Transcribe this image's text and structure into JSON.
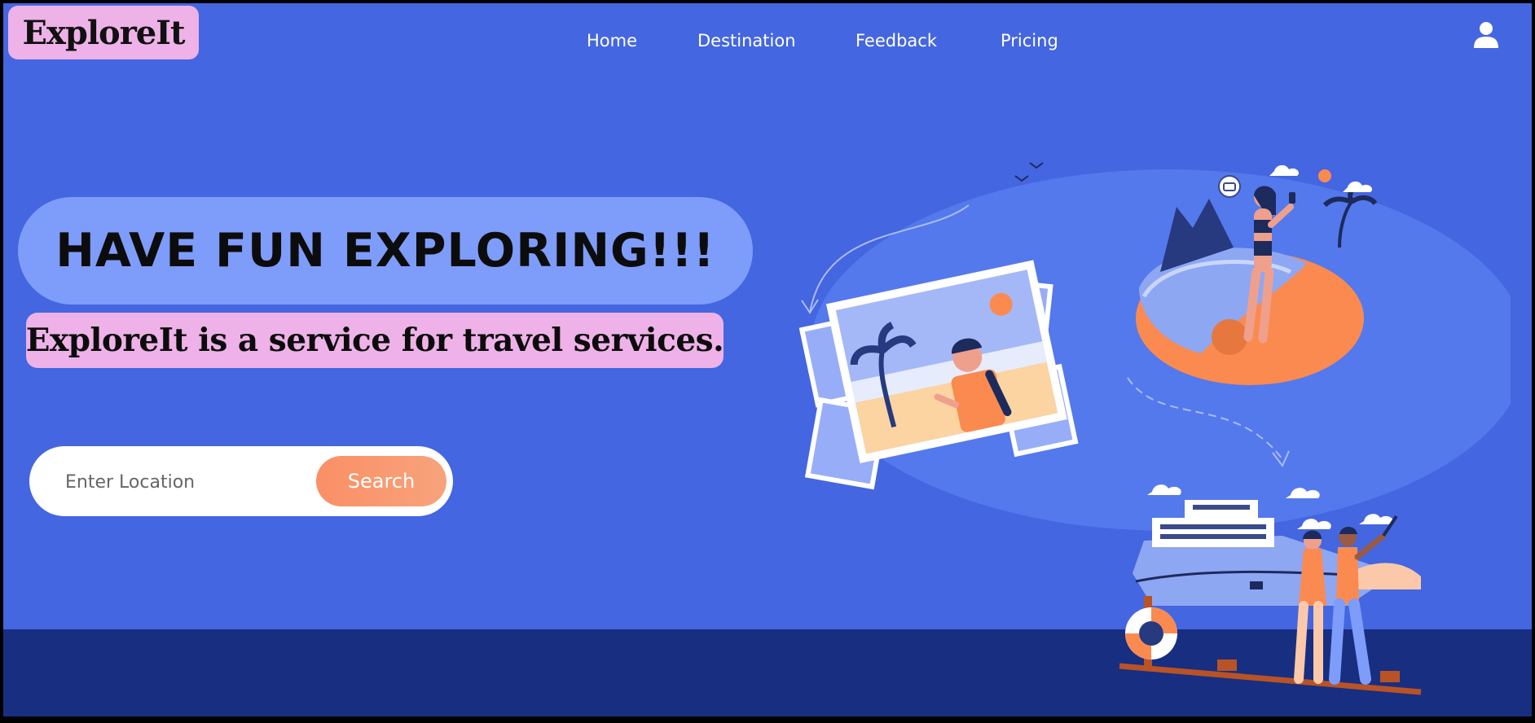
{
  "brand": {
    "logo_text": "ExploreIt"
  },
  "nav": {
    "items": [
      {
        "label": "Home"
      },
      {
        "label": "Destination"
      },
      {
        "label": "Feedback"
      },
      {
        "label": "Pricing"
      }
    ],
    "user_icon": "user-icon"
  },
  "hero": {
    "headline": "HAVE FUN EXPLORING!!!",
    "subheadline": "ExploreIt is a service for travel services."
  },
  "search": {
    "placeholder": "Enter Location",
    "value": "",
    "button_label": "Search"
  },
  "illustration": {
    "icon": "travel-illustration",
    "camera_icon": "camera-icon"
  },
  "colors": {
    "background": "#4466E0",
    "bottom_band": "#182E80",
    "logo_bg": "#EEB2E8",
    "hero_pill": "#7E9CFA",
    "accent": "#FA8F66"
  }
}
